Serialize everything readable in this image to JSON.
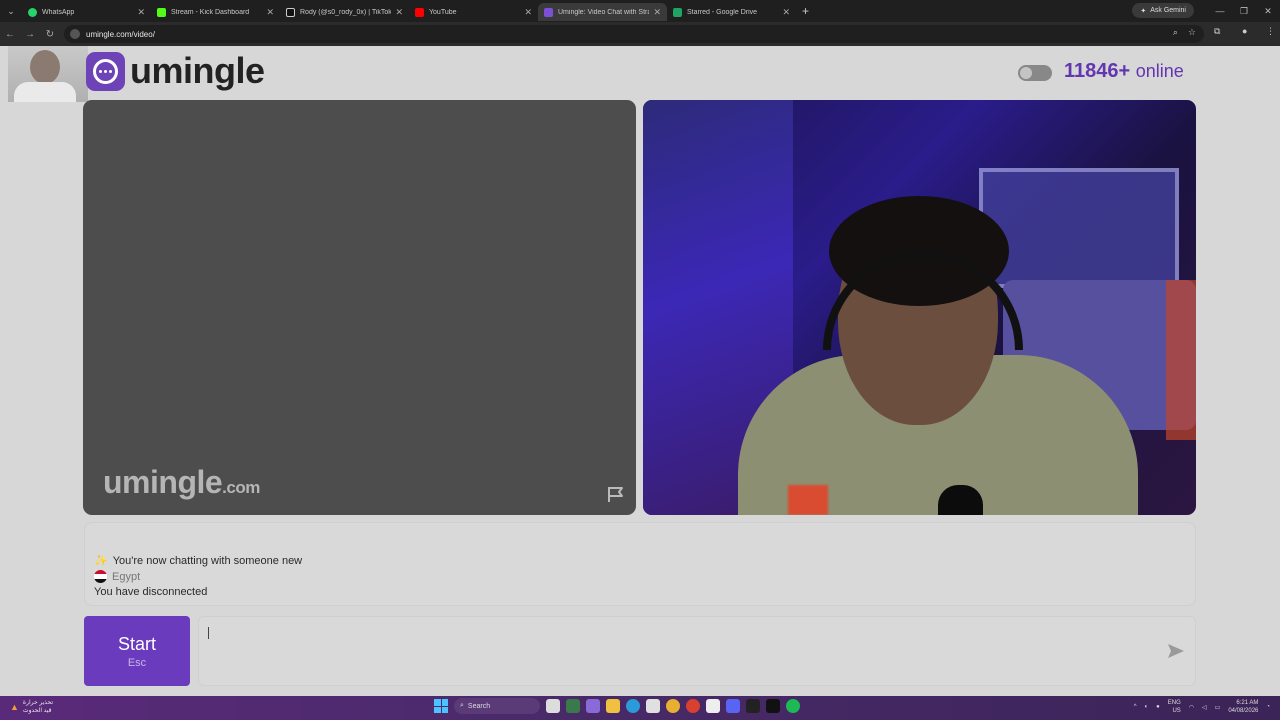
{
  "browser": {
    "tabs": [
      {
        "title": "WhatsApp",
        "color": "#25d366"
      },
      {
        "title": "Stream - Kick Dashboard",
        "color": "#53fc18"
      },
      {
        "title": "Rody (@s0_rody_0x) | TikTok",
        "color": "#ffffff"
      },
      {
        "title": "YouTube",
        "color": "#ff0000"
      },
      {
        "title": "Umingle: Video Chat with Stra",
        "color": "#7d4fd4"
      },
      {
        "title": "Starred - Google Drive",
        "color": "#1fa463"
      }
    ],
    "active_tab_index": 4,
    "ask_gemini": "Ask Gemini",
    "url": "umingle.com/video/"
  },
  "header": {
    "logo_text": "umingle",
    "online_count": "11846+",
    "online_label": "online"
  },
  "video_left": {
    "watermark_main": "umingle",
    "watermark_suffix": ".com"
  },
  "chat": {
    "lines": [
      {
        "text": "You're now chatting with someone new"
      },
      {
        "text": "Egypt"
      },
      {
        "text": "You have disconnected"
      }
    ]
  },
  "controls": {
    "start_label": "Start",
    "start_shortcut": "Esc"
  },
  "taskbar": {
    "weather_line1": "تحذير حرارة",
    "weather_line2": "قيد الحدوث",
    "search_label": "Search",
    "lang_line1": "ENG",
    "lang_line2": "US",
    "time": "6:21 AM",
    "date": "04/08/2026"
  },
  "colors": {
    "brand_purple": "#6e43b8",
    "online_purple": "#6236b0"
  }
}
